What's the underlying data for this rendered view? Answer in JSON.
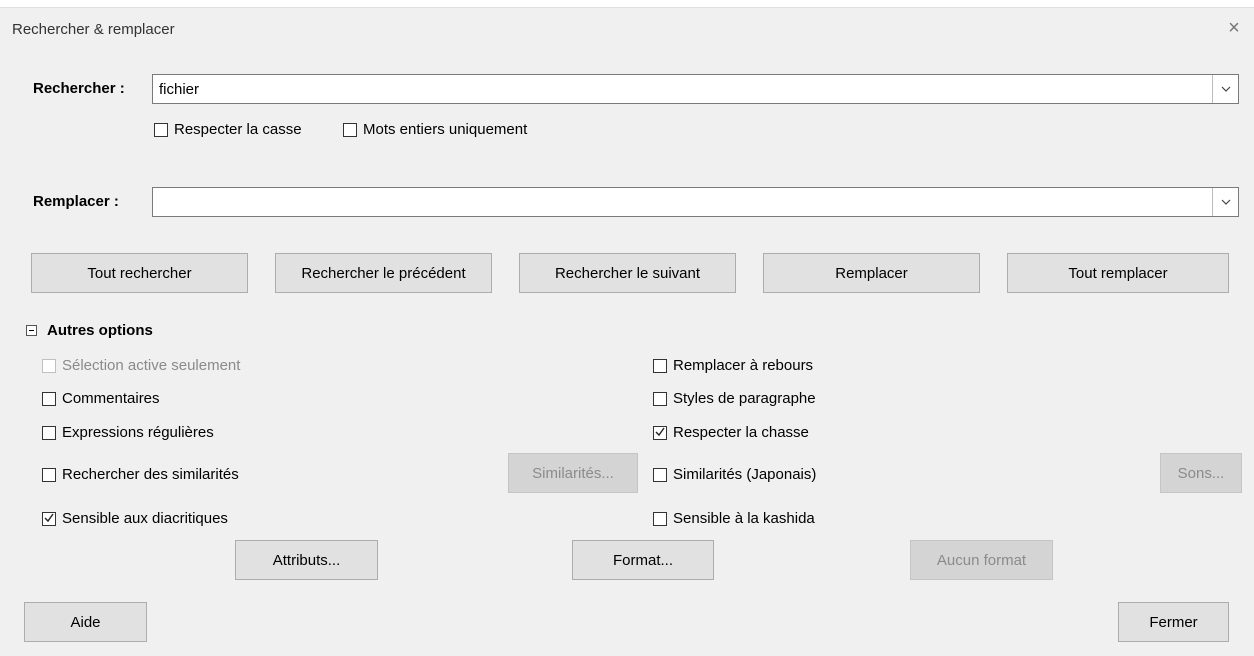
{
  "window": {
    "title": "Rechercher & remplacer",
    "close_glyph": "×"
  },
  "search": {
    "label": "Rechercher :",
    "value": "fichier",
    "options": [
      {
        "label": "Respecter la casse",
        "checked": false
      },
      {
        "label": "Mots entiers uniquement",
        "checked": false
      }
    ]
  },
  "replace": {
    "label": "Remplacer :",
    "value": ""
  },
  "actions": {
    "find_all": "Tout rechercher",
    "find_previous": "Rechercher le précédent",
    "find_next": "Rechercher le suivant",
    "replace": "Remplacer",
    "replace_all": "Tout remplacer"
  },
  "more_options": {
    "label": "Autres options",
    "expanded": true,
    "left": [
      {
        "label": "Sélection active seulement",
        "checked": false,
        "disabled": true
      },
      {
        "label": "Commentaires",
        "checked": false,
        "disabled": false
      },
      {
        "label": "Expressions régulières",
        "checked": false,
        "disabled": false
      },
      {
        "label": "Rechercher des similarités",
        "checked": false,
        "disabled": false
      },
      {
        "label": "Sensible aux diacritiques",
        "checked": true,
        "disabled": false
      }
    ],
    "right": [
      {
        "label": "Remplacer à rebours",
        "checked": false,
        "disabled": false
      },
      {
        "label": "Styles de paragraphe",
        "checked": false,
        "disabled": false
      },
      {
        "label": "Respecter la chasse",
        "checked": true,
        "disabled": false
      },
      {
        "label": "Similarités (Japonais)",
        "checked": false,
        "disabled": false
      },
      {
        "label": "Sensible à la kashida",
        "checked": false,
        "disabled": false
      }
    ],
    "similarities_button": "Similarités...",
    "sounds_button": "Sons...",
    "attributes_button": "Attributs...",
    "format_button": "Format...",
    "no_format_button": "Aucun format"
  },
  "footer": {
    "help": "Aide",
    "close": "Fermer"
  }
}
